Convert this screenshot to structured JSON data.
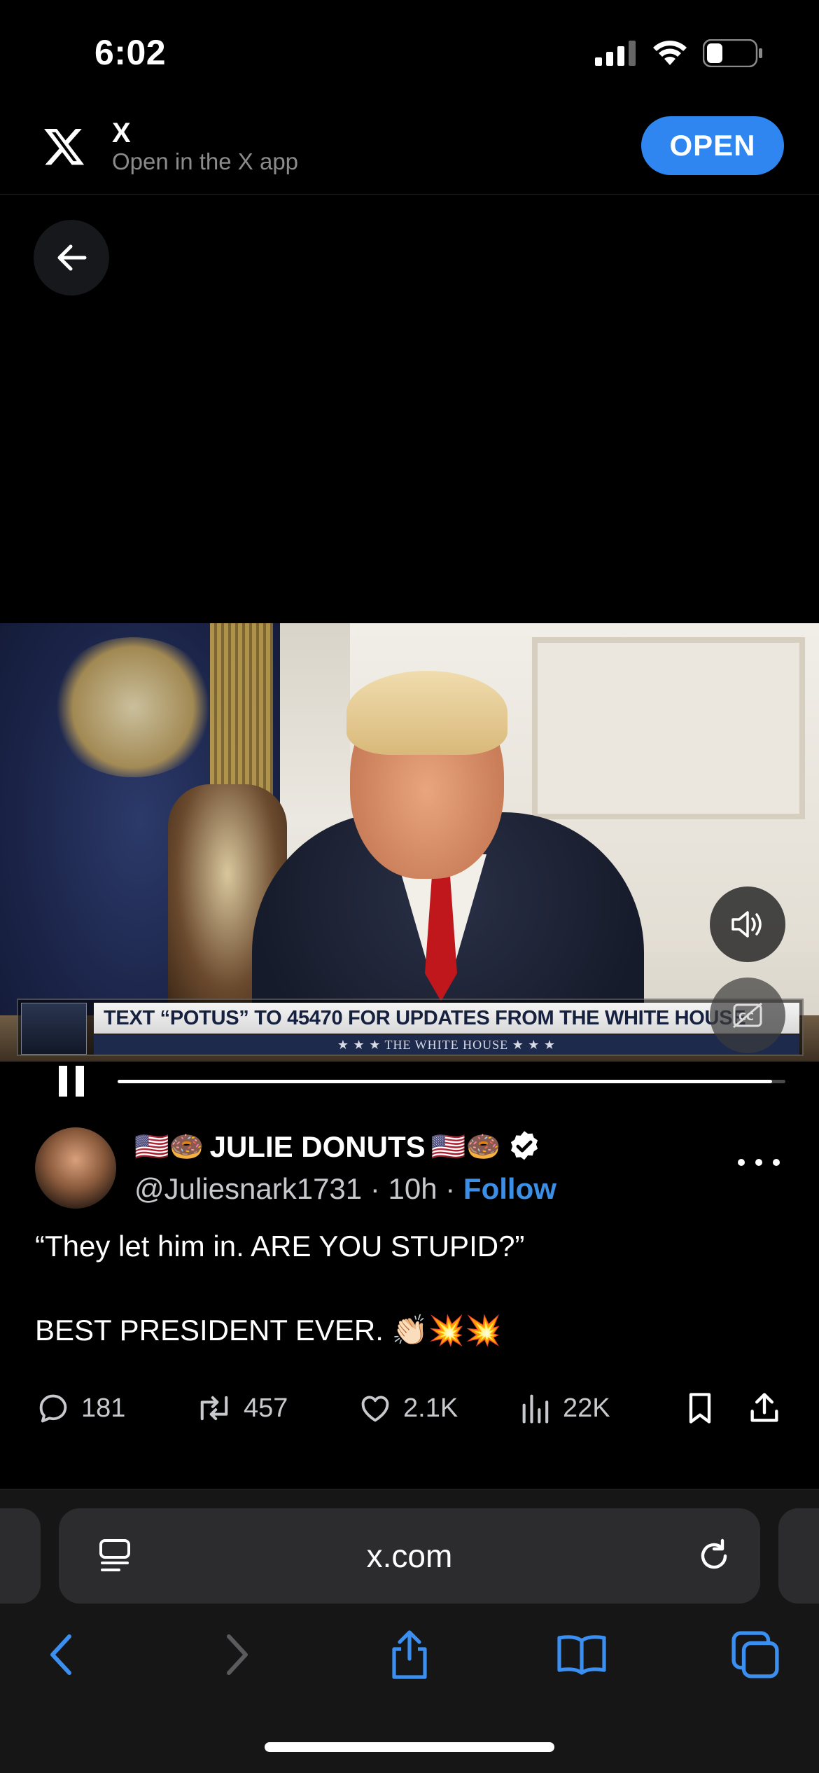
{
  "status_bar": {
    "time": "6:02"
  },
  "app_banner": {
    "name": "X",
    "subtitle": "Open in the X app",
    "open_label": "OPEN"
  },
  "video": {
    "lower_third_main": "TEXT “POTUS” TO 45470 FOR UPDATES FROM THE WHITE HOUSE",
    "lower_third_sub": "★ ★ ★   THE WHITE HOUSE   ★ ★ ★",
    "progress": 0.98
  },
  "tweet": {
    "author_name": "JULIE DONUTS",
    "name_prefix_emoji": "🇺🇸🍩",
    "name_suffix_emoji": "🇺🇸🍩",
    "handle": "@Juliesnark1731",
    "separator": "·",
    "time": "10h",
    "follow_label": "Follow",
    "text": "“They let him in. ARE YOU STUPID?”\n\nBEST PRESIDENT EVER. 👏🏻💥💥",
    "stats": {
      "replies": "181",
      "reposts": "457",
      "likes": "2.1K",
      "views": "22K"
    }
  },
  "browser": {
    "url": "x.com"
  },
  "colors": {
    "accent": "#2f86f0",
    "link": "#3b8fe6",
    "background": "#000000"
  }
}
